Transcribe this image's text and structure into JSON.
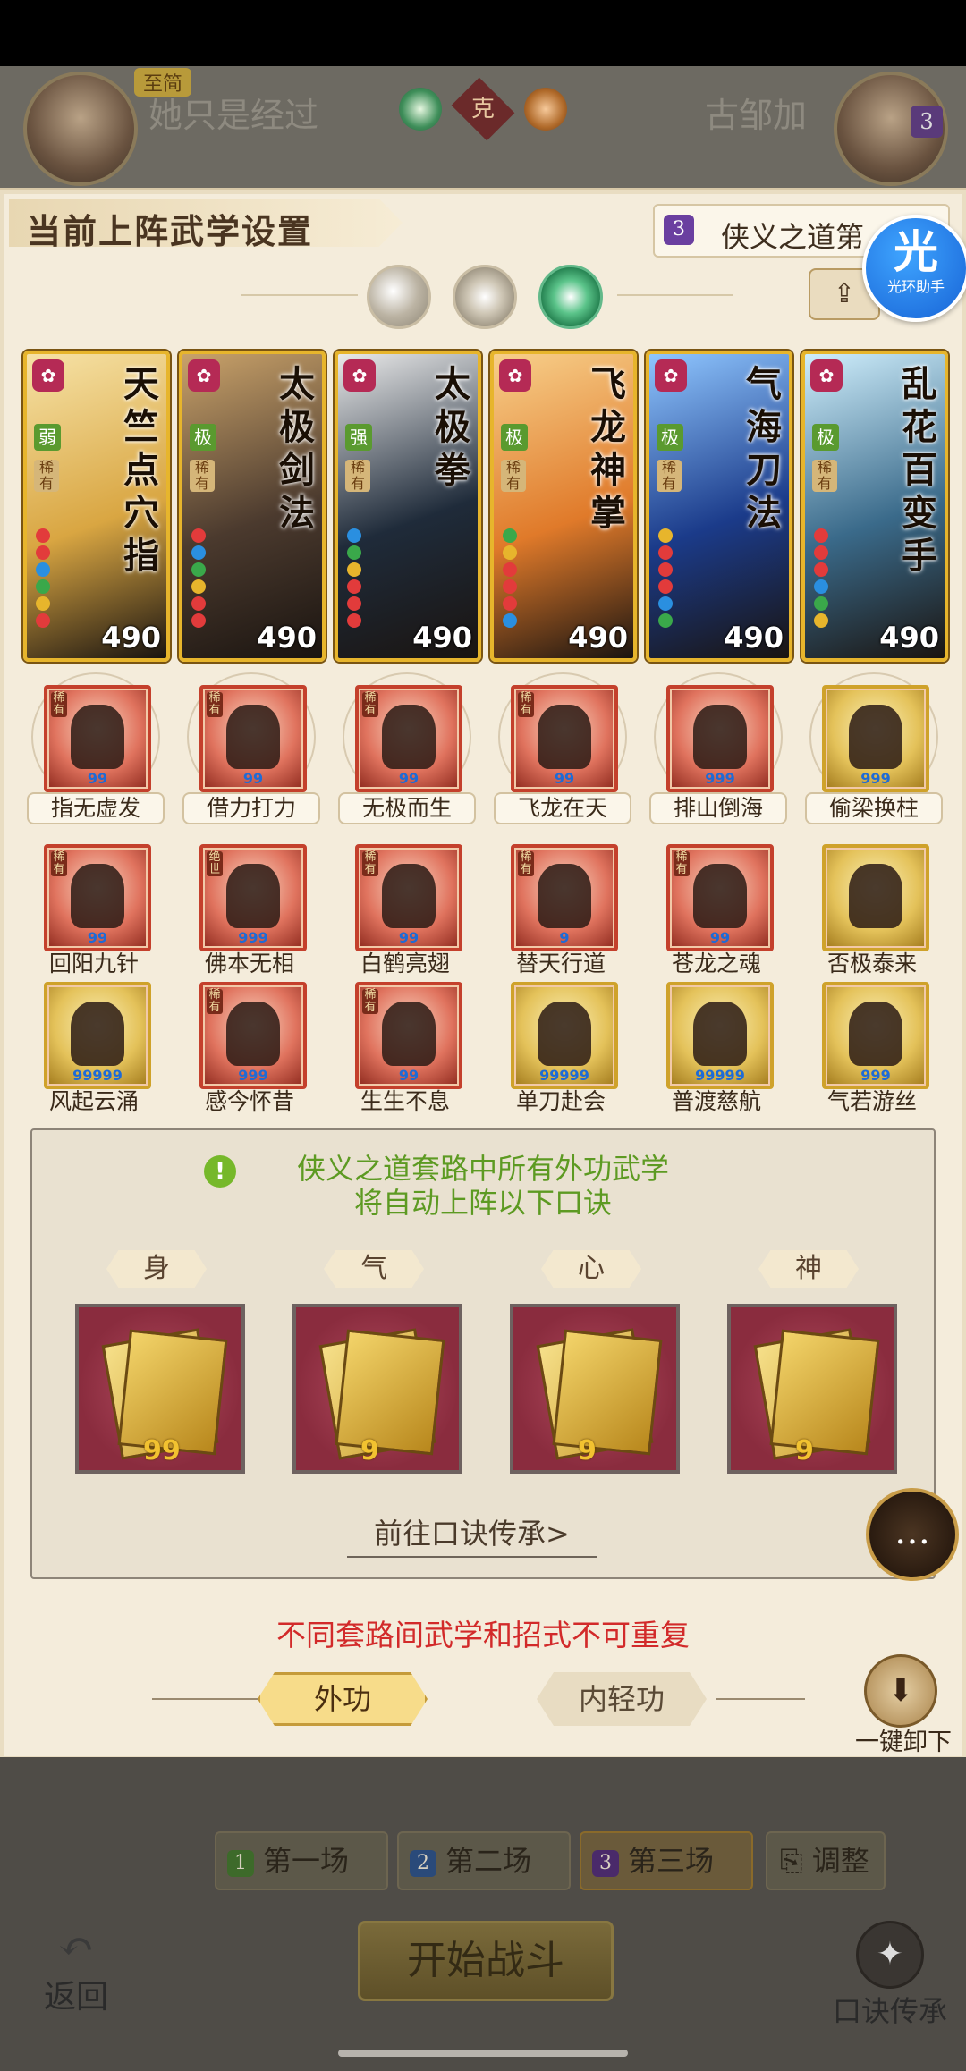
{
  "header": {
    "badge": "至简",
    "player_left": "她只是经过",
    "vs_mark": "克",
    "player_right": "古邹加",
    "right_count": "3"
  },
  "panel": {
    "title": "当前上阵武学设置",
    "route_num": "3",
    "route_name": "侠义之道第",
    "helper_big": "光",
    "helper_small": "光环助手",
    "share_icon": "share-icon"
  },
  "cards": [
    {
      "name": "天竺点穴指",
      "grade": "弱",
      "rare": "稀有",
      "power": "490",
      "bg": "#d9a642",
      "accent": "#f6e2a6"
    },
    {
      "name": "太极剑法",
      "grade": "极",
      "rare": "稀有",
      "power": "490",
      "bg": "#4b3a2e",
      "accent": "#c9a26a"
    },
    {
      "name": "太极拳",
      "grade": "强",
      "rare": "稀有",
      "power": "490",
      "bg": "#1f2b3a",
      "accent": "#e9e9e9"
    },
    {
      "name": "飞龙神掌",
      "grade": "极",
      "rare": "稀有",
      "power": "490",
      "bg": "#e07a2a",
      "accent": "#f7cf8a"
    },
    {
      "name": "气海刀法",
      "grade": "极",
      "rare": "稀有",
      "power": "490",
      "bg": "#1b3b8a",
      "accent": "#8fc6ff"
    },
    {
      "name": "乱花百变手",
      "grade": "极",
      "rare": "稀有",
      "power": "490",
      "bg": "#3a6a8a",
      "accent": "#cfeefc"
    }
  ],
  "skills_row1": [
    {
      "name": "指无虚发",
      "tag": "稀有",
      "pips": "99",
      "gold": false
    },
    {
      "name": "借力打力",
      "tag": "稀有",
      "pips": "99",
      "gold": false
    },
    {
      "name": "无极而生",
      "tag": "稀有",
      "pips": "99",
      "gold": false
    },
    {
      "name": "飞龙在天",
      "tag": "稀有",
      "pips": "99",
      "gold": false
    },
    {
      "name": "排山倒海",
      "tag": "",
      "pips": "999",
      "gold": false
    },
    {
      "name": "偷梁换柱",
      "tag": "",
      "pips": "999",
      "gold": true
    }
  ],
  "skills_row2": [
    {
      "name": "回阳九针",
      "tag": "稀有",
      "pips": "99",
      "gold": false
    },
    {
      "name": "佛本无相",
      "tag": "绝世",
      "pips": "999",
      "gold": false
    },
    {
      "name": "白鹤亮翅",
      "tag": "稀有",
      "pips": "99",
      "gold": false
    },
    {
      "name": "替天行道",
      "tag": "稀有",
      "pips": "9",
      "gold": false
    },
    {
      "name": "苍龙之魂",
      "tag": "稀有",
      "pips": "99",
      "gold": false
    },
    {
      "name": "否极泰来",
      "tag": "",
      "pips": "",
      "gold": true
    }
  ],
  "skills_row3": [
    {
      "name": "风起云涌",
      "tag": "",
      "pips": "99999",
      "gold": true
    },
    {
      "name": "感今怀昔",
      "tag": "稀有",
      "pips": "999",
      "gold": false
    },
    {
      "name": "生生不息",
      "tag": "稀有",
      "pips": "99",
      "gold": false
    },
    {
      "name": "单刀赴会",
      "tag": "",
      "pips": "99999",
      "gold": true
    },
    {
      "name": "普渡慈航",
      "tag": "",
      "pips": "99999",
      "gold": true
    },
    {
      "name": "气若游丝",
      "tag": "",
      "pips": "999",
      "gold": true
    }
  ],
  "koujue": {
    "message_line1": "侠义之道套路中所有外功武学",
    "message_line2": "将自动上阵以下口诀",
    "slots": [
      {
        "label": "身",
        "level": "99"
      },
      {
        "label": "气",
        "level": "9"
      },
      {
        "label": "心",
        "level": "9"
      },
      {
        "label": "神",
        "level": "9"
      }
    ],
    "link": "前往口诀传承>"
  },
  "warning": "不同套路间武学和招式不可重复",
  "tabs": {
    "outer": "外功",
    "inner": "内轻功"
  },
  "unload_label": "一键卸下",
  "rounds": [
    {
      "num": "1",
      "label": "第一场",
      "color": "#3d6a2a"
    },
    {
      "num": "2",
      "label": "第二场",
      "color": "#2a4a7a"
    },
    {
      "num": "3",
      "label": "第三场",
      "color": "#4a2a6a"
    }
  ],
  "adjust": "调整",
  "start_battle": "开始战斗",
  "back": "返回",
  "koujue_inherit": "口诀传承"
}
